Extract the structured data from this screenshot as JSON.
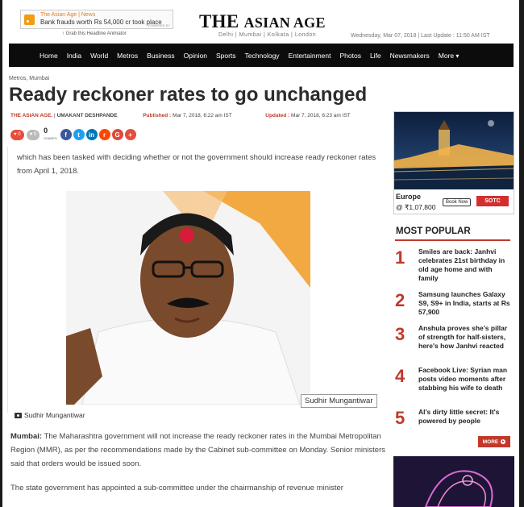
{
  "ticker": {
    "source": "The Asian Age | News",
    "headline": "Bank frauds worth Rs 54,000 cr took place",
    "powered": "POWERED BY",
    "grab": "↑ Grab this Headline Animator"
  },
  "masthead": {
    "logo_the": "THE ",
    "logo_name": "ASIAN AGE",
    "cities": "Delhi | Mumbai | Kolkata | London",
    "dateline": "Wednesday, Mar 07, 2018 | Last Update : 11:50 AM IST"
  },
  "nav": {
    "items": [
      "Home",
      "India",
      "World",
      "Metros",
      "Business",
      "Opinion",
      "Sports",
      "Technology",
      "Entertainment",
      "Photos",
      "Life",
      "Newsmakers",
      "More"
    ]
  },
  "article": {
    "breadcrumb": "Metros, Mumbai",
    "title": "Ready reckoner rates to go unchanged",
    "source": "THE ASIAN AGE.",
    "author": "UMAKANT DESHPANDE",
    "published_label": "Published :",
    "published": "Mar 7, 2018, 6:22 am IST",
    "updated_label": "Updated :",
    "updated": "Mar 7, 2018, 6:23 am IST",
    "lead": "which has been tasked with deciding whether or not the government should increase ready reckoner rates from April 1, 2018.",
    "photo_tag": "Sudhir Mungantiwar",
    "caption": "Sudhir Mungantiwar",
    "para1_place": "Mumbai:",
    "para1": " The Maharashtra government will not increase the ready reckoner rates in the Mumbai Metropolitan Region (MMR), as per the recommendations made by the Cabinet sub-committee on Monday. Senior ministers said that orders would be issued soon.",
    "para2": "The state government has appointed a sub-committee under the chairmanship of revenue minister"
  },
  "shares": {
    "like_count": "0",
    "dislike_count": "0",
    "share_count": "0",
    "share_label": "SHARES"
  },
  "sidebar_ad": {
    "destination": "Europe",
    "price": "@ ₹1,07,800",
    "book": "Book Now",
    "brand": "SOTC"
  },
  "most_popular": {
    "title": "MOST POPULAR",
    "items": [
      {
        "rank": "1",
        "text": "Smiles are back: Janhvi celebrates 21st birthday in old age home and with family"
      },
      {
        "rank": "2",
        "text": "Samsung launches Galaxy S9, S9+ in India, starts at Rs 57,900"
      },
      {
        "rank": "3",
        "text": "Anshula proves she's pillar of strength for half-sisters, here's how Janhvi reacted"
      },
      {
        "rank": "4",
        "text": "Facebook Live: Syrian man posts video moments after stabbing his wife to death"
      },
      {
        "rank": "5",
        "text": "Al's dirty little secret: It's powered by people"
      }
    ],
    "more": "MORE"
  },
  "colors": {
    "accent": "#c0392b",
    "nav_bg": "#0c0c0c"
  }
}
